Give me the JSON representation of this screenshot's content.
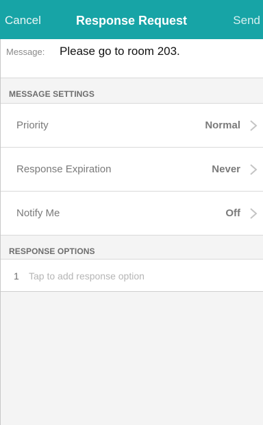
{
  "navbar": {
    "cancel_label": "Cancel",
    "title": "Response Request",
    "send_label": "Send",
    "accent_color": "#17a4a6"
  },
  "message": {
    "label": "Message:",
    "text": "Please go to room 203."
  },
  "message_settings": {
    "header": "MESSAGE SETTINGS",
    "items": [
      {
        "label": "Priority",
        "value": "Normal",
        "icon": "chevron-right-icon"
      },
      {
        "label": "Response Expiration",
        "value": "Never",
        "icon": "chevron-right-icon"
      },
      {
        "label": "Notify Me",
        "value": "Off",
        "icon": "chevron-right-icon"
      }
    ]
  },
  "response_options": {
    "header": "RESPONSE OPTIONS",
    "items": [
      {
        "index": "1",
        "placeholder": "Tap to add response option"
      }
    ]
  }
}
